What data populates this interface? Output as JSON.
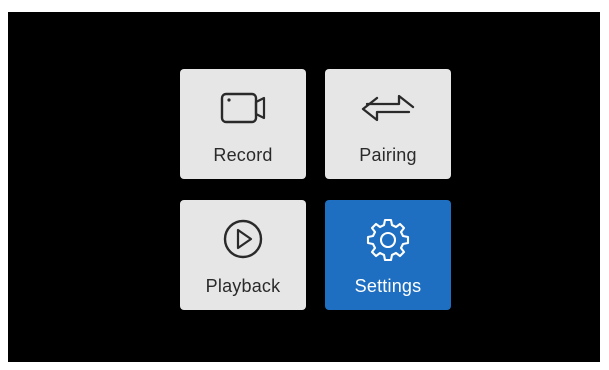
{
  "menu": {
    "items": [
      {
        "label": "Record",
        "icon": "camera-icon",
        "active": false
      },
      {
        "label": "Pairing",
        "icon": "swap-arrows-icon",
        "active": false
      },
      {
        "label": "Playback",
        "icon": "play-circle-icon",
        "active": false
      },
      {
        "label": "Settings",
        "icon": "gear-icon",
        "active": true
      }
    ]
  },
  "colors": {
    "background": "#000000",
    "tile": "#e6e6e6",
    "tile_text": "#2a2a2a",
    "active_tile": "#1e6fc1",
    "active_text": "#ffffff"
  }
}
